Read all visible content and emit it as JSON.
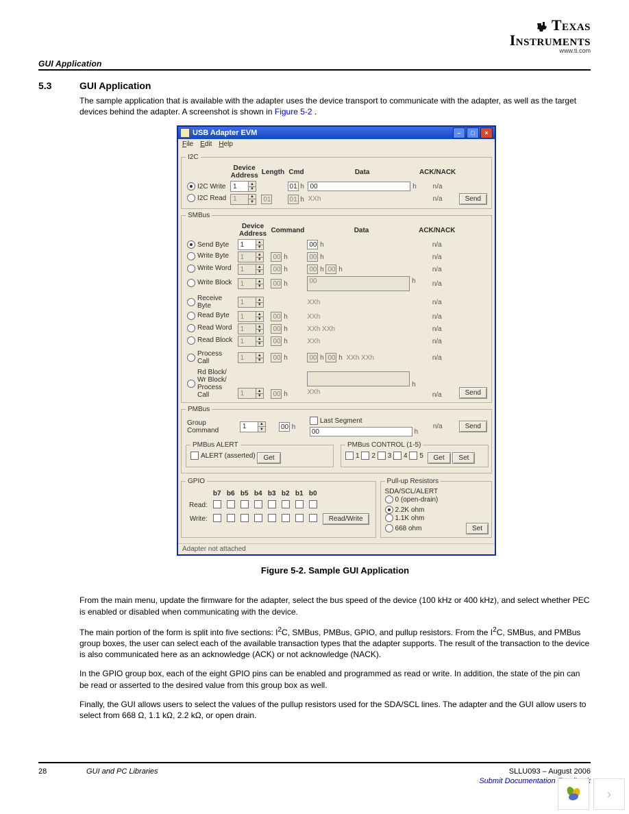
{
  "logo": {
    "top": "Texas",
    "bottom": "Instruments",
    "url": "www.ti.com"
  },
  "running_head": "GUI Application",
  "section": {
    "number": "5.3",
    "title": "GUI Application"
  },
  "para1": "The sample application that is available with the adapter uses the device transport to communicate with the adapter, as well as the target devices behind the adapter. A screenshot is shown in ",
  "figref": "Figure 5-2",
  "figref_tail": ".",
  "app": {
    "title": "USB Adapter EVM",
    "menu": {
      "file": "File",
      "edit": "Edit",
      "help": "Help"
    },
    "groups": {
      "i2c": {
        "legend": "I2C",
        "hdr": {
          "addr": "Device\nAddress",
          "length": "Length",
          "cmd": "Cmd",
          "data": "Data",
          "ack": "ACK/NACK"
        },
        "rows": {
          "write": {
            "label": "I2C Write",
            "addr": "1",
            "cmd_val": "01",
            "data_val": "00",
            "ack": "n/a"
          },
          "read": {
            "label": "I2C Read",
            "addr": "1",
            "len_val": "01",
            "cmd_val": "01",
            "data_val": "XXh",
            "ack": "n/a"
          }
        },
        "send": "Send"
      },
      "smbus": {
        "legend": "SMBus",
        "hdr": {
          "addr": "Device\nAddress",
          "command": "Command",
          "data": "Data",
          "ack": "ACK/NACK"
        },
        "rows": {
          "send_byte": {
            "label": "Send Byte",
            "addr": "1",
            "data": "00",
            "ack": "n/a"
          },
          "write_byte": {
            "label": "Write Byte",
            "addr": "1",
            "cmd": "00",
            "data": "00",
            "ack": "n/a"
          },
          "write_word": {
            "label": "Write Word",
            "addr": "1",
            "cmd": "00",
            "d1": "00",
            "d2": "00",
            "ack": "n/a"
          },
          "write_block": {
            "label": "Write Block",
            "addr": "1",
            "cmd": "00",
            "blk": "00",
            "ack": "n/a"
          },
          "recv_byte": {
            "label": "Receive\nByte",
            "addr": "1",
            "data": "XXh",
            "ack": "n/a"
          },
          "read_byte": {
            "label": "Read Byte",
            "addr": "1",
            "cmd": "00",
            "data": "XXh",
            "ack": "n/a"
          },
          "read_word": {
            "label": "Read Word",
            "addr": "1",
            "cmd": "00",
            "data": "XXh  XXh",
            "ack": "n/a"
          },
          "read_block": {
            "label": "Read Block",
            "addr": "1",
            "cmd": "00",
            "data": "XXh",
            "ack": "n/a"
          },
          "process_call": {
            "label": "Process\nCall",
            "addr": "1",
            "cmd": "00",
            "d1": "00",
            "d2": "00",
            "data": "XXh  XXh",
            "ack": "n/a"
          },
          "rdwr_block": {
            "label": "Rd Block/\nWr Block/\nProcess\nCall",
            "addr": "1",
            "cmd": "00",
            "blk": "",
            "resp": "XXh",
            "ack": "n/a"
          }
        },
        "send": "Send"
      },
      "pmbus": {
        "legend": "PMBus",
        "group_cmd": {
          "label": "Group\nCommand",
          "addr": "1",
          "cmd": "00",
          "last_seg": "Last Segment",
          "data": "00",
          "ack": "n/a",
          "send": "Send"
        },
        "alert": {
          "title": "PMBus ALERT",
          "chk": "ALERT (asserted)",
          "get": "Get"
        },
        "control": {
          "title": "PMBus CONTROL (1-5)",
          "get": "Get",
          "set": "Set"
        }
      },
      "gpio": {
        "legend": "GPIO",
        "bits": [
          "b7",
          "b6",
          "b5",
          "b4",
          "b3",
          "b2",
          "b1",
          "b0"
        ],
        "read": "Read:",
        "write": "Write:",
        "btn": "Read/Write"
      },
      "pullup": {
        "legend": "Pull-up Resistors",
        "subtitle": "SDA/SCL/ALERT",
        "opts": {
          "open": "0 (open-drain)",
          "r22": "2.2K ohm",
          "r11": "1.1K ohm",
          "r668": "668 ohm"
        },
        "set": "Set"
      }
    },
    "h": "h",
    "status": "Adapter not attached"
  },
  "caption": "Figure 5-2. Sample GUI Application",
  "para2": "From the main menu, update the firmware for the adapter, select the bus speed of the device (100 kHz or 400 kHz), and select whether PEC is enabled or disabled when communicating with the device.",
  "para3a": "The main portion of the form is split into five sections: I",
  "para3sup1": "2",
  "para3b": "C, SMBus, PMBus, GPIO, and pullup resistors. From the I",
  "para3sup2": "2",
  "para3c": "C, SMBus, and PMBus group boxes, the user can select each of the available transaction types that the adapter supports. The result of the transaction to the device is also communicated here as an acknowledge (ACK) or not acknowledge (NACK).",
  "para4": "In the GPIO group box, each of the eight GPIO pins can be enabled and programmed as read or write. In addition, the state of the pin can be read or asserted to the desired value from this group box as well.",
  "para5a": "Finally, the GUI allows users to select the values of the pullup resistors used for the SDA/SCL lines. The adapter and the GUI allow users to select from 668 ",
  "ohm": "Ω",
  "para5b": ", 1.1 k",
  "para5c": ", 2.2 k",
  "para5d": ", or open drain.",
  "footer": {
    "page": "28",
    "title": "GUI and PC Libraries",
    "docid": "SLLU093 – August 2006",
    "feedback": "Submit Documentation Feedback"
  }
}
